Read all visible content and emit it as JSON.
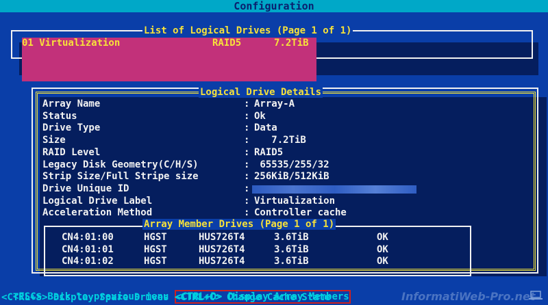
{
  "header": {
    "title": "Configuration"
  },
  "list_panel": {
    "title": "List of Logical Drives (Page 1 of 1)",
    "selected_row": {
      "name": "01 Virtualization",
      "raid": "RAID5",
      "size": "7.2TiB"
    }
  },
  "details_panel": {
    "title": "Logical Drive Details",
    "rows": [
      {
        "label": "Array Name",
        "value": "Array-A"
      },
      {
        "label": "Status",
        "value": "Ok"
      },
      {
        "label": "Drive Type",
        "value": "Data"
      },
      {
        "label": "Size",
        "value": "   7.2TiB"
      },
      {
        "label": "RAID Level",
        "value": "RAID5"
      },
      {
        "label": "Legacy Disk Geometry(C/H/S)",
        "value": " 65535/255/32"
      },
      {
        "label": "Strip Size/Full Stripe size",
        "value": "256KiB/512KiB"
      },
      {
        "label": "Drive Unique ID",
        "value": ""
      },
      {
        "label": "Logical Drive Label",
        "value": "Virtualization"
      },
      {
        "label": "Acceleration Method",
        "value": "Controller cache"
      }
    ],
    "separator": ":"
  },
  "members_panel": {
    "title": "Array Member Drives (Page 1 of 1)",
    "drives": [
      {
        "port": "CN4:01:00",
        "vendor": "HGST",
        "model": "HUS726T4",
        "size": "3.6TiB",
        "status": "OK"
      },
      {
        "port": "CN4:01:01",
        "vendor": "HGST",
        "model": "HUS726T4",
        "size": "3.6TiB",
        "status": "OK"
      },
      {
        "port": "CN4:01:02",
        "vendor": "HGST",
        "model": "HUS726T4",
        "size": "3.6TiB",
        "status": "OK"
      }
    ]
  },
  "footer": {
    "line1_left": "<ESC> Back to previous menu ",
    "line1_highlight": "<CTRL+D> Display Array Members",
    "line2": "<CTRL+S> Display Spare Drives <CTRL+C> Change Cache State"
  },
  "watermark": {
    "text": "InformatiWeb-Pro.net",
    "icon": "laptop-icon"
  },
  "colors": {
    "background": "#0a3ea8",
    "title_bar": "#00a8c8",
    "panel_title": "#f7e13a",
    "selection": "#c2317a",
    "footer_text": "#00d0e0",
    "highlight_border": "#d0201e"
  }
}
